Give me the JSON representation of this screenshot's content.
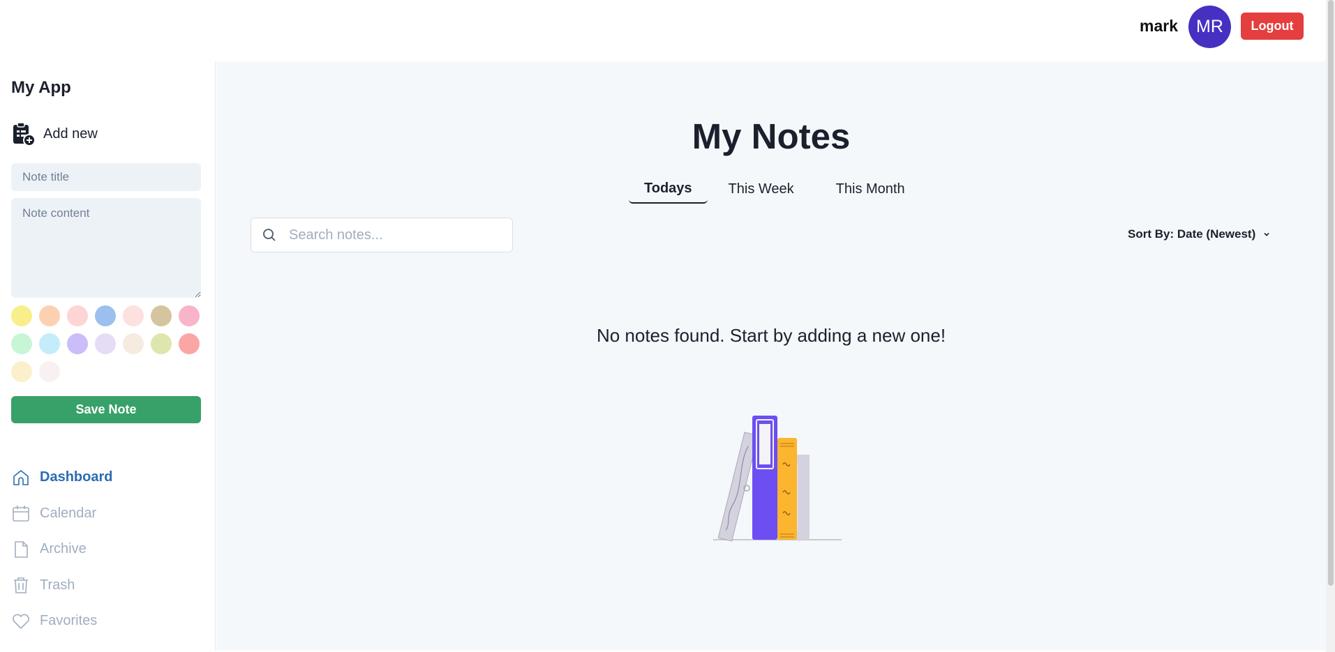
{
  "header": {
    "user_name": "mark",
    "avatar_initials": "MR",
    "logout_label": "Logout"
  },
  "sidebar": {
    "app_title": "My App",
    "add_new_label": "Add new",
    "note_title_placeholder": "Note title",
    "note_content_placeholder": "Note content",
    "colors": [
      "#f9ee8c",
      "#fdd0b1",
      "#fed4d4",
      "#9cbff0",
      "#fde0e0",
      "#d4c59e",
      "#f8b4c8",
      "#c6f6d5",
      "#c4ecfa",
      "#cbbdf9",
      "#e5dcf6",
      "#f6ebdf",
      "#dfe6ad",
      "#fca5a5",
      "#faf1cc",
      "#f9f1f1"
    ],
    "save_label": "Save Note",
    "nav": {
      "dashboard": "Dashboard",
      "calendar": "Calendar",
      "archive": "Archive",
      "trash": "Trash",
      "favorites": "Favorites"
    },
    "active_nav": "Dashboard"
  },
  "main": {
    "title": "My Notes",
    "tabs": [
      "Todays",
      "This Week",
      "This Month"
    ],
    "active_tab": "Todays",
    "search_placeholder": "Search notes...",
    "sort_label": "Sort By: Date (Newest)",
    "empty_message": "No notes found. Start by adding a new one!"
  },
  "colors": {
    "avatar": "#4630c2",
    "logout": "#e53e3e",
    "save": "#38a169",
    "active_nav": "#2b6cb0",
    "main_bg": "#f5f8fb"
  }
}
